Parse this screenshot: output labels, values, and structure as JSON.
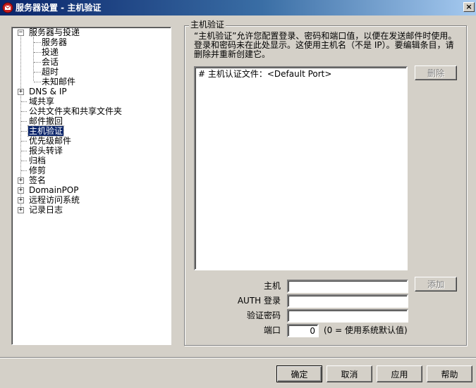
{
  "window": {
    "title": "服务器设置 - 主机验证",
    "close_glyph": "×"
  },
  "tree": {
    "items": [
      {
        "label": "服务器与投递",
        "expander": "−"
      },
      {
        "label": "服务器"
      },
      {
        "label": "投递"
      },
      {
        "label": "会话"
      },
      {
        "label": "超时"
      },
      {
        "label": "未知邮件"
      },
      {
        "label": "DNS & IP",
        "expander": "+"
      },
      {
        "label": "域共享"
      },
      {
        "label": "公共文件夹和共享文件夹"
      },
      {
        "label": "邮件撤回"
      },
      {
        "label": "主机验证"
      },
      {
        "label": "优先级邮件"
      },
      {
        "label": "报头转译"
      },
      {
        "label": "归档"
      },
      {
        "label": "修剪"
      },
      {
        "label": "签名",
        "expander": "+"
      },
      {
        "label": "DomainPOP",
        "expander": "+"
      },
      {
        "label": "远程访问系统",
        "expander": "+"
      },
      {
        "label": "记录日志",
        "expander": "+"
      }
    ]
  },
  "panel": {
    "group_title": "主机验证",
    "description": "“主机验证”允许您配置登录、密码和端口值，以便在发送邮件时使用。登录和密码未在此处显示。这使用主机名（不是 IP）。要编辑条目，请删除并重新创建它。",
    "list_items": [
      "# 主机认证文件：<Default Port>"
    ],
    "delete_label": "删除",
    "add_label": "添加",
    "host_label": "主机",
    "auth_label": "AUTH 登录",
    "password_label": "验证密码",
    "port_label": "端口",
    "host_value": "",
    "auth_value": "",
    "password_value": "",
    "port_value": "0",
    "port_hint": "(0 = 使用系统默认值)"
  },
  "footer": {
    "ok_label": "确定",
    "cancel_label": "取消",
    "apply_label": "应用",
    "help_label": "帮助"
  },
  "colors": {
    "titlebar": "#0a246a",
    "face": "#d4d0c8",
    "selection": "#0a246a"
  }
}
